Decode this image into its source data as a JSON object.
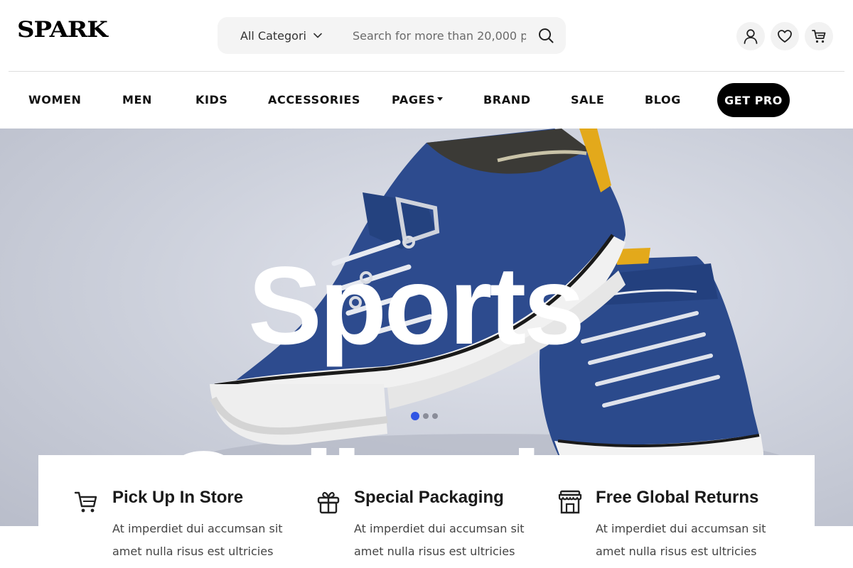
{
  "header": {
    "logo": "SPARK",
    "search": {
      "category_label": "All Categori",
      "placeholder": "Search for more than 20,000 p"
    },
    "icons": [
      "user-icon",
      "heart-icon",
      "cart-icon"
    ]
  },
  "nav": {
    "items": [
      {
        "label": "WOMEN"
      },
      {
        "label": "MEN"
      },
      {
        "label": "KIDS"
      },
      {
        "label": "ACCESSORIES"
      },
      {
        "label": "PAGES"
      },
      {
        "label": "BRAND"
      },
      {
        "label": "SALE"
      },
      {
        "label": "BLOG"
      }
    ],
    "cta": "GET PRO"
  },
  "hero": {
    "title": "Sports",
    "subtitle": "Collection",
    "slides": 3,
    "active_slide": 1,
    "accent_color": "#2f55e4"
  },
  "features": [
    {
      "icon": "cart-icon",
      "title": "Pick Up In Store",
      "text": "At imperdiet dui accumsan sit amet nulla risus est ultricies"
    },
    {
      "icon": "gift-icon",
      "title": "Special Packaging",
      "text": "At imperdiet dui accumsan sit amet nulla risus est ultricies"
    },
    {
      "icon": "store-icon",
      "title": "Free Global Returns",
      "text": "At imperdiet dui accumsan sit amet nulla risus est ultricies"
    }
  ]
}
